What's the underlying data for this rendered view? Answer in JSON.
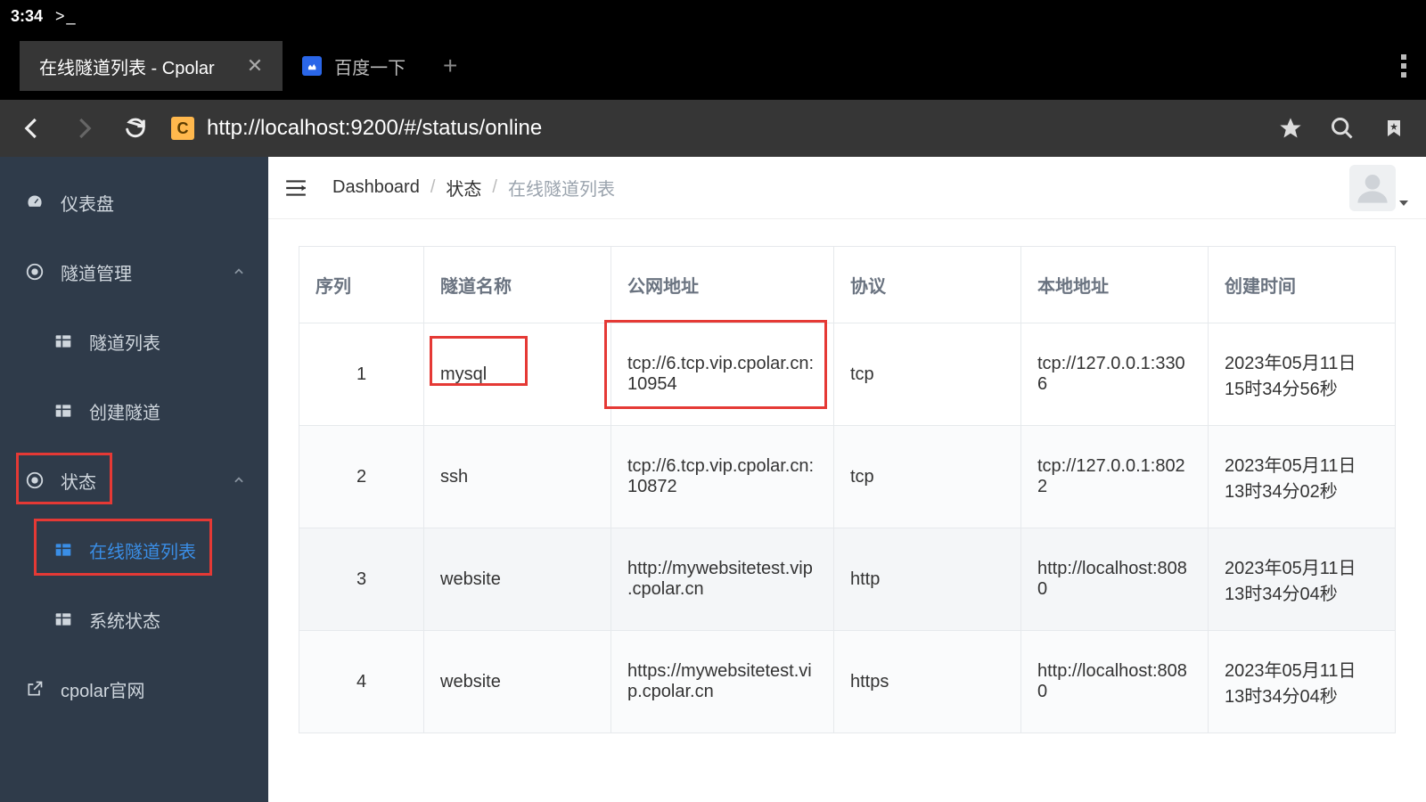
{
  "statusbar": {
    "time": "3:34",
    "prompt": ">_"
  },
  "tabs": {
    "active": {
      "title": "在线隧道列表 - Cpolar"
    },
    "inactive": {
      "title": "百度一下"
    }
  },
  "toolbar": {
    "url": "http://localhost:9200/#/status/online"
  },
  "sidebar": {
    "dashboard": "仪表盘",
    "tunnel_mgmt": "隧道管理",
    "tunnel_list": "隧道列表",
    "tunnel_create": "创建隧道",
    "status": "状态",
    "online_list": "在线隧道列表",
    "system_status": "系统状态",
    "official_site": "cpolar官网"
  },
  "breadcrumb": {
    "dashboard": "Dashboard",
    "status": "状态",
    "current": "在线隧道列表"
  },
  "table": {
    "headers": {
      "seq": "序列",
      "name": "隧道名称",
      "public": "公网地址",
      "proto": "协议",
      "local": "本地地址",
      "created": "创建时间"
    },
    "rows": [
      {
        "seq": "1",
        "name": "mysql",
        "public": "tcp://6.tcp.vip.cpolar.cn:10954",
        "proto": "tcp",
        "local": "tcp://127.0.0.1:3306",
        "created": "2023年05月11日 15时34分56秒"
      },
      {
        "seq": "2",
        "name": "ssh",
        "public": "tcp://6.tcp.vip.cpolar.cn:10872",
        "proto": "tcp",
        "local": "tcp://127.0.0.1:8022",
        "created": "2023年05月11日 13时34分02秒"
      },
      {
        "seq": "3",
        "name": "website",
        "public": "http://mywebsitetest.vip.cpolar.cn",
        "proto": "http",
        "local": "http://localhost:8080",
        "created": "2023年05月11日 13时34分04秒"
      },
      {
        "seq": "4",
        "name": "website",
        "public": "https://mywebsitetest.vip.cpolar.cn",
        "proto": "https",
        "local": "http://localhost:8080",
        "created": "2023年05月11日 13时34分04秒"
      }
    ]
  }
}
